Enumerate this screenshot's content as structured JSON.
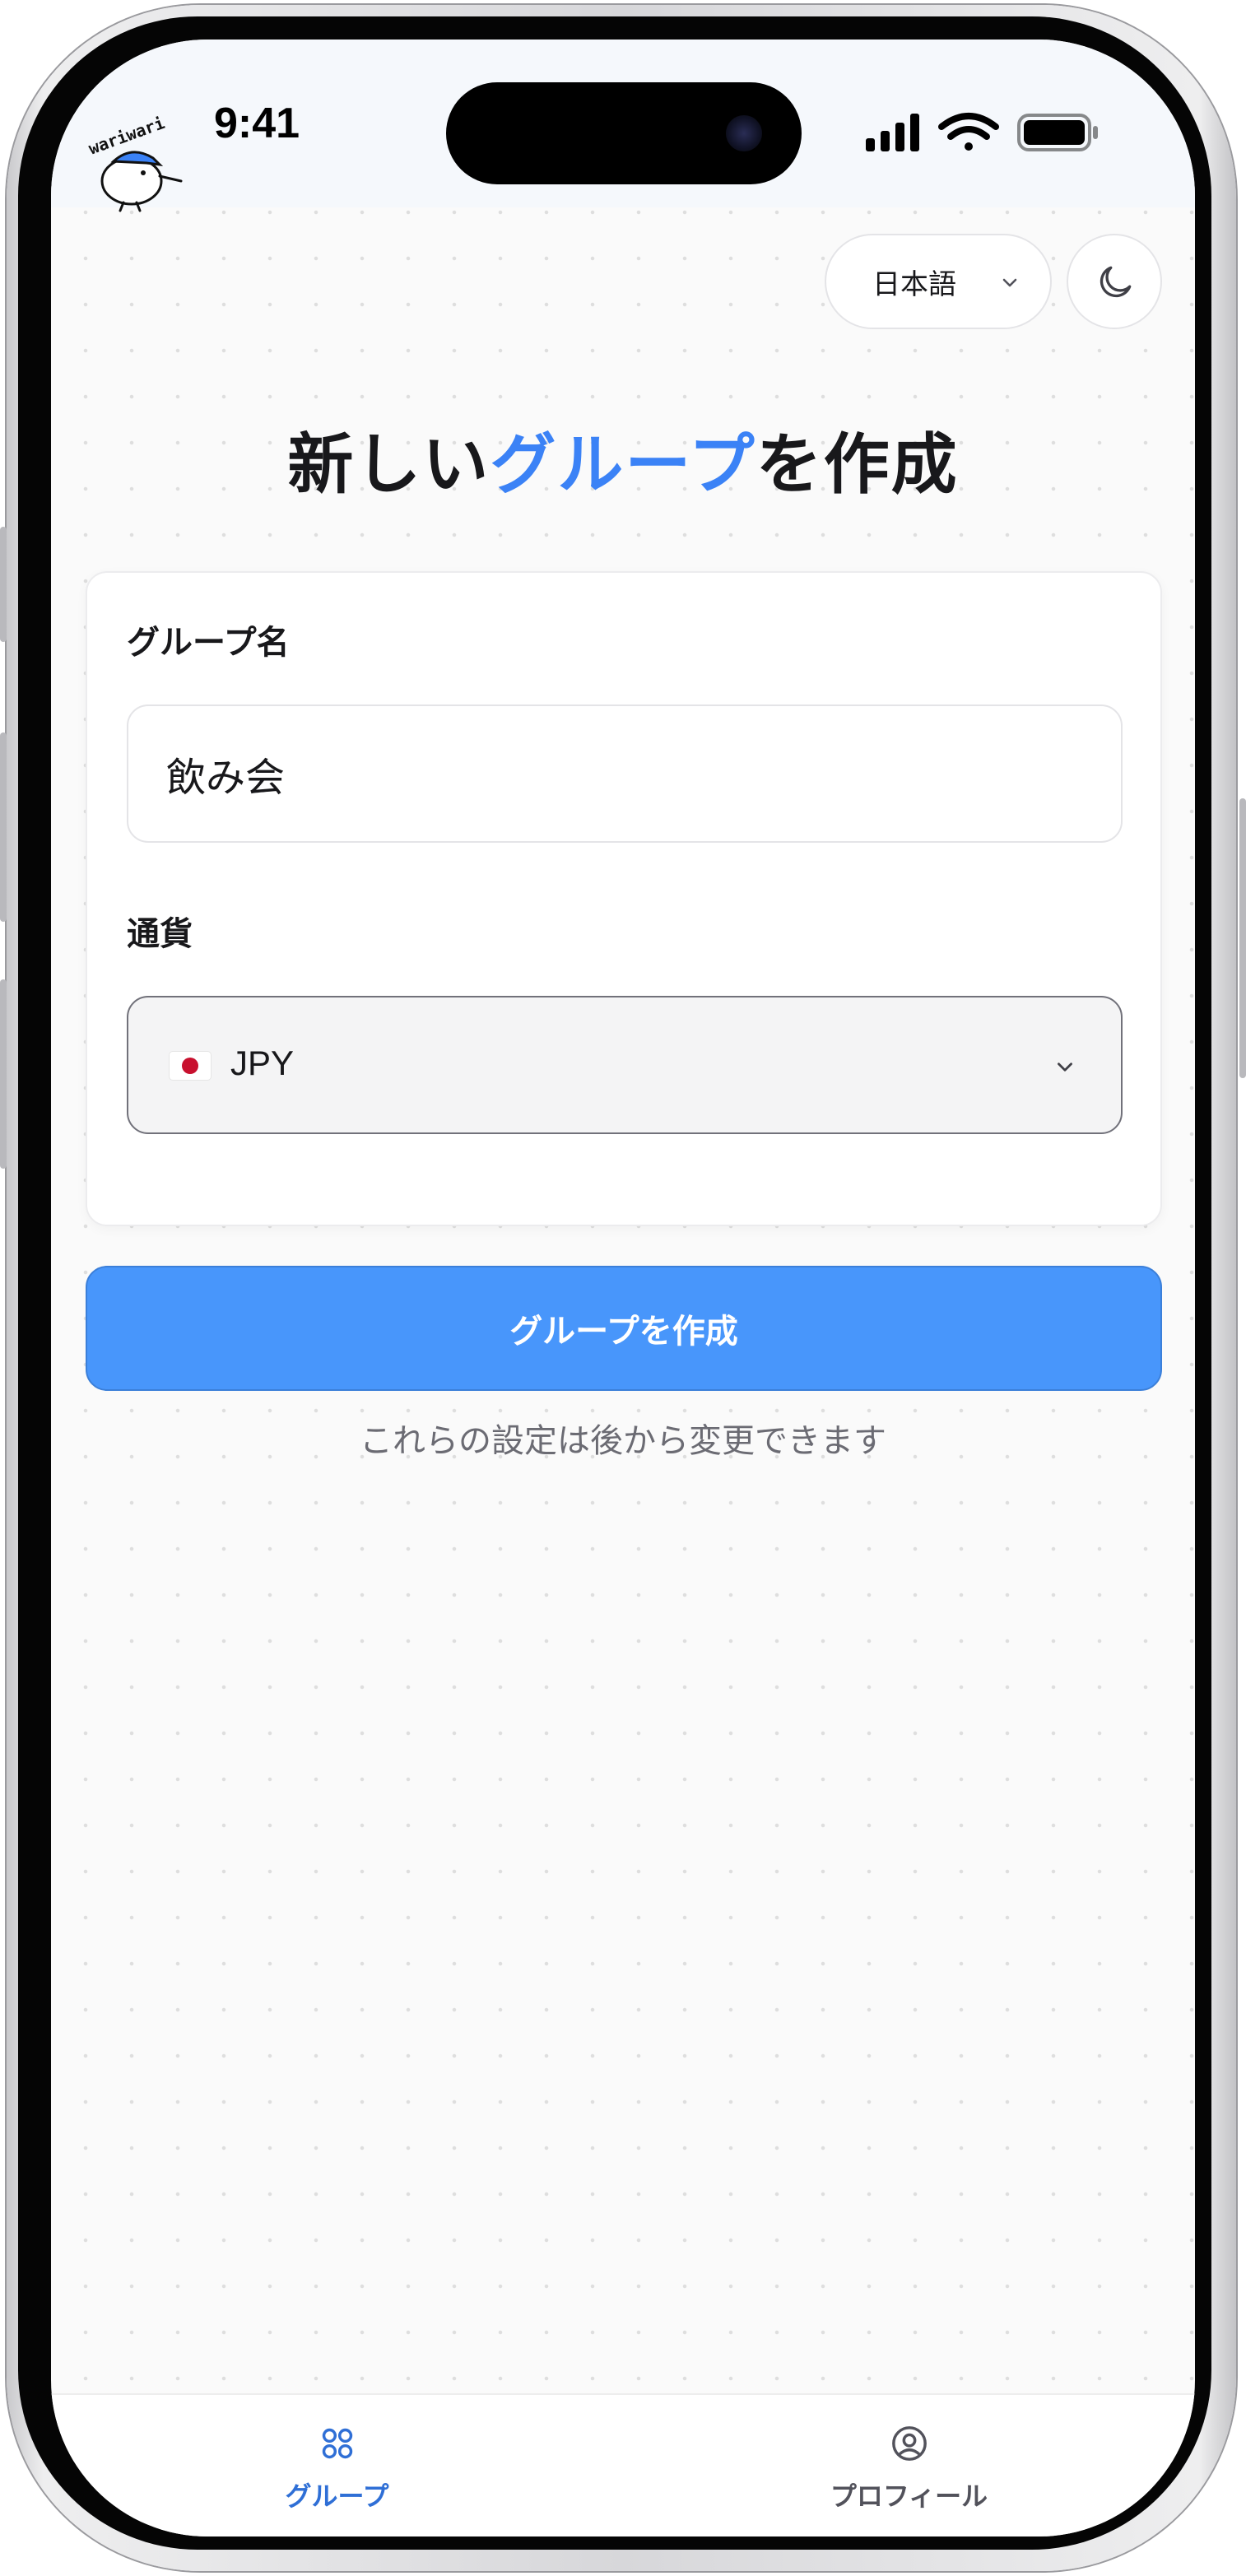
{
  "status_bar": {
    "time": "9:41"
  },
  "header": {
    "logo_text": "wariwari",
    "language_label": "日本語",
    "theme_icon": "moon-icon"
  },
  "page": {
    "title_part1": "新しい",
    "title_accent": "グループ",
    "title_part2": "を作成"
  },
  "form": {
    "group_name_label": "グループ名",
    "group_name_value": "飲み会",
    "currency_label": "通貨",
    "currency_value": "JPY",
    "currency_flag": "japan-flag-icon"
  },
  "actions": {
    "create_button": "グループを作成",
    "hint": "これらの設定は後から変更できます"
  },
  "tab_bar": {
    "tabs": [
      {
        "label": "グループ",
        "icon": "grid-icon",
        "active": true
      },
      {
        "label": "プロフィール",
        "icon": "user-circle-icon",
        "active": false
      }
    ]
  },
  "colors": {
    "accent": "#3b82f6",
    "button": "#4896fb",
    "tab_active": "#2f6fd6",
    "tab_inactive": "#52525b"
  }
}
